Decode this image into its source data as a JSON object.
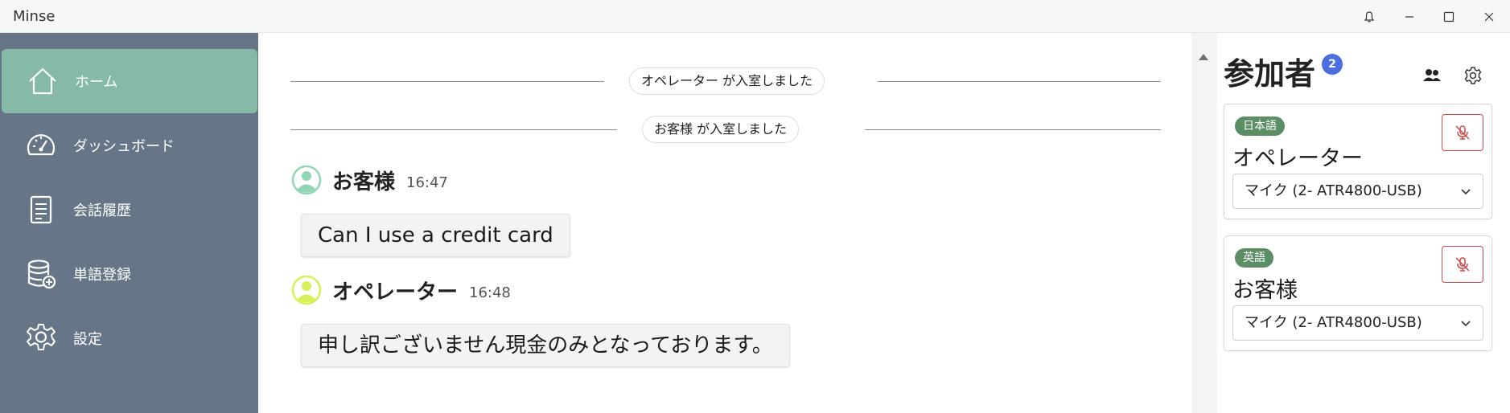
{
  "window": {
    "title": "Minse",
    "controls": [
      "bell-icon",
      "minimize-icon",
      "maximize-icon",
      "close-icon"
    ]
  },
  "sidebar": {
    "items": [
      {
        "label": "ホーム",
        "icon": "home-icon",
        "active": true
      },
      {
        "label": "ダッシュボード",
        "icon": "dashboard-gauge-icon",
        "active": false
      },
      {
        "label": "会話履歴",
        "icon": "document-icon",
        "active": false
      },
      {
        "label": "単語登録",
        "icon": "database-add-icon",
        "active": false
      },
      {
        "label": "設定",
        "icon": "gear-icon",
        "active": false
      }
    ]
  },
  "chat": {
    "system_messages": [
      {
        "text": "オペレーター が入室しました"
      },
      {
        "text": "お客様 が入室しました"
      }
    ],
    "messages": [
      {
        "sender": "お客様",
        "time": "16:47",
        "text": "Can I use a credit card",
        "avatar_color": "#8fd6b4"
      },
      {
        "sender": "オペレーター",
        "time": "16:48",
        "text": "申し訳ございません現金のみとなっております。",
        "avatar_color": "#d9ef5a"
      }
    ]
  },
  "panel": {
    "title": "参加者",
    "count": "2",
    "participants": [
      {
        "language": "日本語",
        "name": "オペレーター",
        "mic": "マイク (2- ATR4800-USB)"
      },
      {
        "language": "英語",
        "name": "お客様",
        "mic": "マイク (2- ATR4800-USB)"
      }
    ]
  },
  "colors": {
    "sidebar_bg": "#667688",
    "sidebar_active": "#86b9a8",
    "badge_blue": "#4b6fe0",
    "language_badge": "#5c8e66",
    "mute_red": "#c94a4a"
  }
}
